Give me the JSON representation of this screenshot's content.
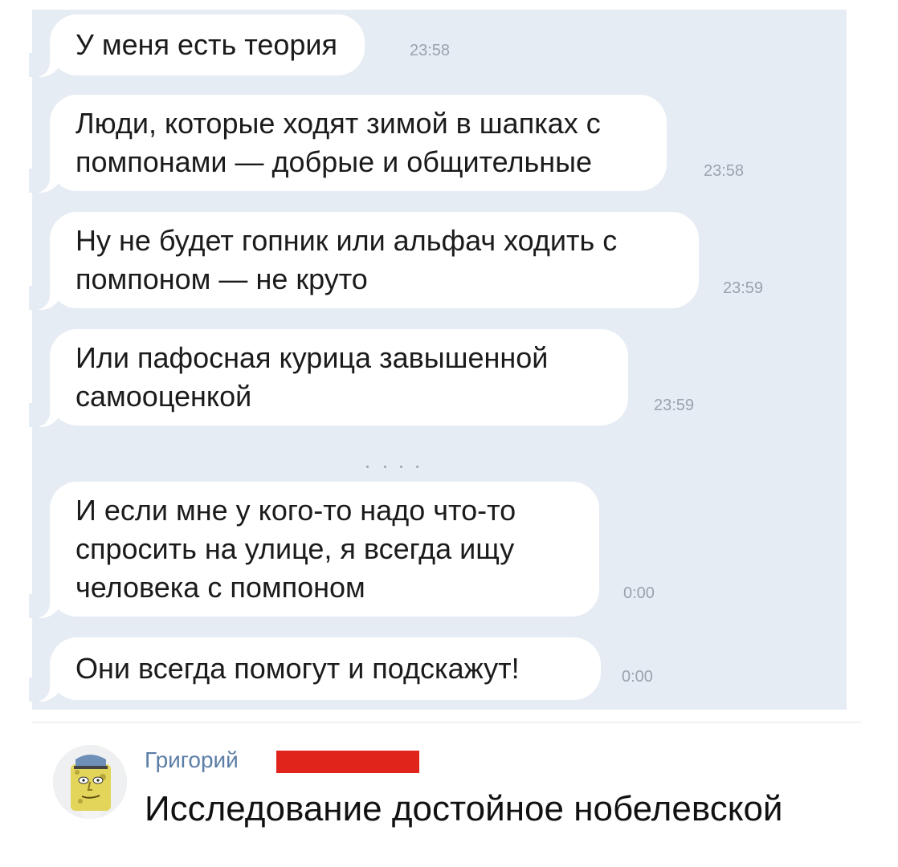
{
  "messages": [
    {
      "lines": [
        "У меня есть теория"
      ],
      "time": "23:58"
    },
    {
      "lines": [
        "Люди, которые ходят зимой в шапках с",
        "помпонами — добрые и общительные"
      ],
      "time": "23:58"
    },
    {
      "lines": [
        "Ну не будет гопник или альфач ходить с",
        "помпоном — не круто"
      ],
      "time": "23:59"
    },
    {
      "lines": [
        "Или пафосная курица завышенной",
        "самооценкой"
      ],
      "time": "23:59"
    },
    {
      "lines": [
        "И если мне у кого-то надо что-то",
        "спросить на улице, я всегда ищу",
        "человека с помпоном"
      ],
      "time": "0:00"
    },
    {
      "lines": [
        "Они всегда помогут и подскажут!"
      ],
      "time": "0:00"
    }
  ],
  "comment": {
    "author": "Григорий",
    "text": "Исследование достойное нобелевской",
    "redaction_color": "#e0241b"
  },
  "colors": {
    "chat_background": "#e6ecf4",
    "bubble": "#ffffff",
    "author_link": "#5b7da6"
  }
}
